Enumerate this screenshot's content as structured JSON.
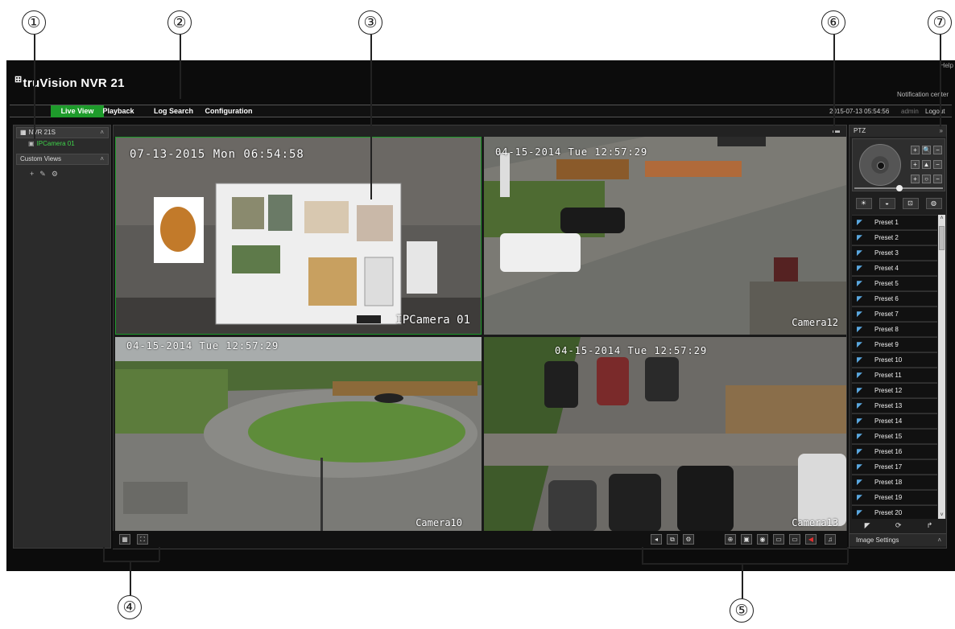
{
  "callouts": [
    "①",
    "②",
    "③",
    "④",
    "⑤",
    "⑥",
    "⑦"
  ],
  "app": {
    "logo": "truVision  NVR 21",
    "notification": "Notification center",
    "corner_mark": "Help"
  },
  "menu": {
    "items": [
      "Live View",
      "Playback",
      "Log Search",
      "Configuration"
    ],
    "active": "Live View"
  },
  "status": {
    "datetime": "2015-07-13 05:54:56",
    "user": "admin",
    "logout": "Logout"
  },
  "sidebar": {
    "device_header": "NVR 21S",
    "camera": "IPCamera 01",
    "custom_views": "Custom Views",
    "view_tools": [
      "+",
      "✎",
      "⚙"
    ]
  },
  "tiles": [
    {
      "timestamp": "07-13-2015 Mon 06:54:58",
      "label": "IPCamera 01"
    },
    {
      "timestamp": "04-15-2014 Tue 12:57:29",
      "label": "Camera12"
    },
    {
      "timestamp": "04-15-2014 Tue 12:57:29",
      "label": "Camera10"
    },
    {
      "timestamp": "04-15-2014 Tue 12:57:29",
      "label": "Camera13"
    }
  ],
  "ptz": {
    "title": "PTZ",
    "presets": [
      "Preset 1",
      "Preset 2",
      "Preset 3",
      "Preset 4",
      "Preset 5",
      "Preset 6",
      "Preset 7",
      "Preset 8",
      "Preset 9",
      "Preset 10",
      "Preset 11",
      "Preset 12",
      "Preset 13",
      "Preset 14",
      "Preset 15",
      "Preset 16",
      "Preset 17",
      "Preset 18",
      "Preset 19",
      "Preset 20"
    ],
    "image_settings": "Image Settings"
  },
  "colors": {
    "accent": "#1e9b2b",
    "background": "#0c0c0c"
  }
}
